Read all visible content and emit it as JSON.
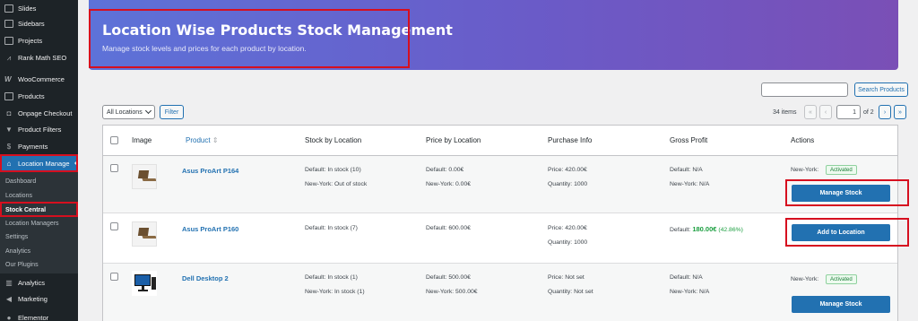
{
  "sidebar": {
    "items": [
      {
        "label": "Slides",
        "icon": "slides-icon"
      },
      {
        "label": "Sidebars",
        "icon": "sidebars-icon"
      },
      {
        "label": "Projects",
        "icon": "projects-icon"
      },
      {
        "label": "Rank Math SEO",
        "icon": "rank-math-icon"
      },
      {
        "label": "WooCommerce",
        "icon": "woocommerce-icon"
      },
      {
        "label": "Products",
        "icon": "products-icon"
      },
      {
        "label": "Onpage Checkout",
        "icon": "cart-icon"
      },
      {
        "label": "Product Filters",
        "icon": "filter-icon"
      },
      {
        "label": "Payments",
        "icon": "payments-icon"
      },
      {
        "label": "Location Manage",
        "icon": "location-icon"
      }
    ],
    "submenu": [
      "Dashboard",
      "Locations",
      "Stock Central",
      "Location Managers",
      "Settings",
      "Analytics",
      "Our Plugins"
    ],
    "bottom_items": [
      {
        "label": "Analytics",
        "icon": "analytics-icon"
      },
      {
        "label": "Marketing",
        "icon": "megaphone-icon"
      },
      {
        "label": "Elementor",
        "icon": "elementor-icon"
      }
    ]
  },
  "banner": {
    "title": "Location Wise Products Stock Management",
    "subtitle": "Manage stock levels and prices for each product by location."
  },
  "search": {
    "button": "Search Products",
    "placeholder": ""
  },
  "filter": {
    "selected": "All Locations",
    "button": "Filter"
  },
  "pagination": {
    "items": "34 items",
    "first": "«",
    "prev": "‹",
    "current": "1",
    "of": "of 2",
    "next": "›",
    "last": "»"
  },
  "table": {
    "headers": {
      "image": "Image",
      "product": "Product",
      "stock": "Stock by Location",
      "price": "Price by Location",
      "purchase": "Purchase Info",
      "profit": "Gross Profit",
      "actions": "Actions"
    },
    "sort_icon": "⇕",
    "rows": [
      {
        "name": "Asus ProArt P164",
        "stock": [
          {
            "label": "Default:",
            "value": "In stock (10)"
          },
          {
            "label": "New-York:",
            "value": "Out of stock"
          }
        ],
        "price": [
          {
            "label": "Default:",
            "value": "0.00€"
          },
          {
            "label": "New-York:",
            "value": "0.00€"
          }
        ],
        "purchase": [
          "Price: 420.00€",
          "Quantity: 1000"
        ],
        "profit": [
          {
            "label": "Default:",
            "value": "N/A"
          },
          {
            "label": "New-York:",
            "value": "N/A"
          }
        ],
        "action_label": "New-York:",
        "badge": "Activated",
        "button": "Manage Stock"
      },
      {
        "name": "Asus ProArt P160",
        "stock": [
          {
            "label": "Default:",
            "value": "In stock (7)"
          }
        ],
        "price": [
          {
            "label": "Default:",
            "value": "600.00€"
          }
        ],
        "purchase": [
          "Price: 420.00€",
          "Quantity: 1000"
        ],
        "profit": [
          {
            "label": "Default:",
            "value": "180.00€",
            "extra": "(42.86%)"
          }
        ],
        "button": "Add to Location"
      },
      {
        "name": "Dell Desktop 2",
        "stock": [
          {
            "label": "Default:",
            "value": "In stock (1)"
          },
          {
            "label": "New-York:",
            "value": "In stock (1)"
          }
        ],
        "price": [
          {
            "label": "Default:",
            "value": "500.00€"
          },
          {
            "label": "New-York:",
            "value": "500.00€"
          }
        ],
        "purchase": [
          "Price: Not set",
          "Quantity: Not set"
        ],
        "profit": [
          {
            "label": "Default:",
            "value": "N/A"
          },
          {
            "label": "New-York:",
            "value": "N/A"
          }
        ],
        "action_label": "New-York:",
        "badge": "Activated",
        "button": "Manage Stock"
      }
    ]
  },
  "colors": {
    "accent": "#2271b1",
    "sidebar_bg": "#1d2327",
    "highlight": "#d60f1f",
    "profit": "#1a9e3f"
  }
}
